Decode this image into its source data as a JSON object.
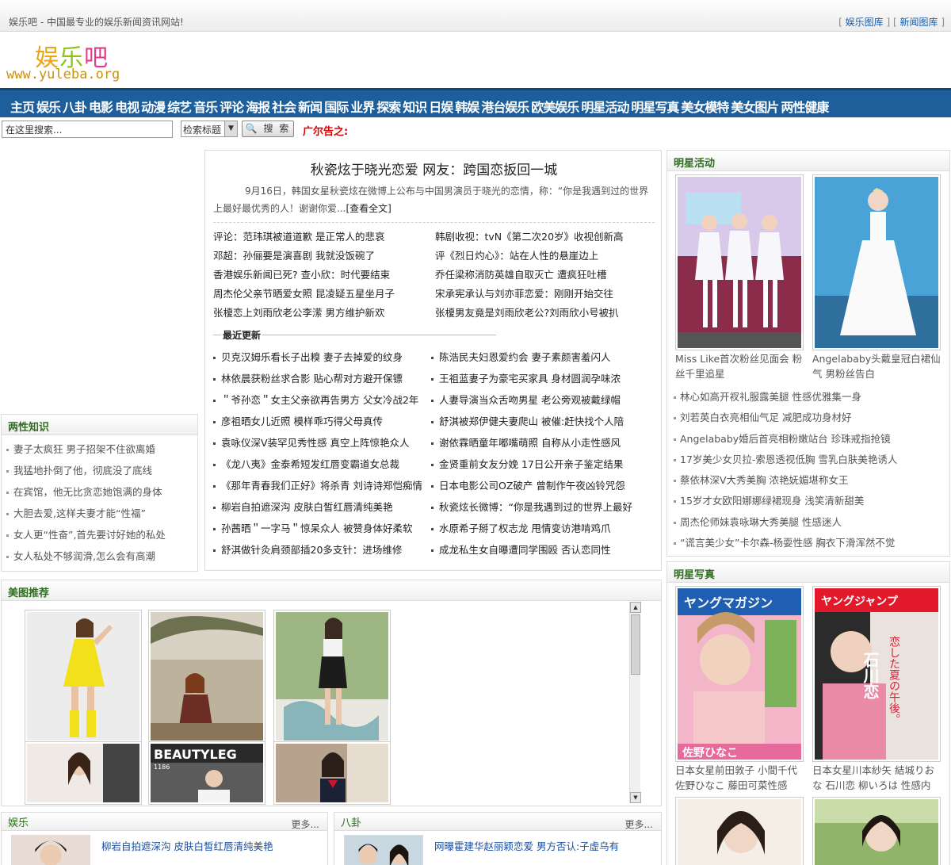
{
  "topbar": {
    "slogan": "娱乐吧 - 中国最专业的娱乐新闻资讯网站!",
    "link1": "娱乐图库",
    "link2": "新闻图库",
    "bracket_open": "[",
    "bracket_close": "]"
  },
  "logo": {
    "c1": "娱",
    "c2": "乐",
    "c3": "吧",
    "url": "www.yuleba.org"
  },
  "nav": [
    "主页",
    "娱乐",
    "八卦",
    "电影",
    "电视",
    "动漫",
    "综艺",
    "音乐",
    "评论",
    "海报",
    "社会",
    "新闻",
    "国际",
    "业界",
    "探索",
    "知识",
    "日娱",
    "韩娱",
    "港台娱乐",
    "欧美娱乐",
    "明星活动",
    "明星写真",
    "美女模特",
    "美女图片",
    "两性健康"
  ],
  "search": {
    "placeholder": "在这里搜索...",
    "select_value": "检索标题",
    "button": "搜 索",
    "ad_label": "广尔告之:"
  },
  "left_panel": {
    "title": "两性知识",
    "items": [
      "妻子太疯狂 男子招架不住欲离婚",
      "我猛地扑倒了他，彻底没了底线",
      "在宾馆，他无比贪恋她饱满的身体",
      "大胆去爱,这样夫妻才能“性福”",
      "女人更“性奋”,首先要讨好她的私处",
      "女人私处不够润滑,怎么会有高潮"
    ]
  },
  "main": {
    "headline": "秋瓷炫于晓光恋爱 网友：跨国恋扳回一城",
    "summary": "9月16日，韩国女星秋瓷炫在微博上公布与中国男演员于晓光的恋情，称：“你是我遇到过的世界上最好最优秀的人！谢谢你爱...",
    "full_link": "[查看全文]",
    "hot_left": [
      "评论：范玮琪被道道歉 是正常人的悲哀",
      "邓超：孙俪要是演喜剧 我就没饭碗了",
      "香港娱乐新闻已死? 查小欣：时代要结束",
      "周杰伦父亲节晒爱女照 昆凌疑五星坐月子",
      "张榎恋上刘雨欣老公李潆 男方维护新欢"
    ],
    "hot_right": [
      "韩剧收视：tvN《第二次20岁》收视创新高",
      "评《烈日灼心》：站在人性的悬崖边上",
      "乔任梁称消防英雄自取灭亡 遭疯狂吐槽",
      "宋承宪承认与刘亦菲恋爱：刚刚开始交往",
      "张榎男友竟是刘雨欣老公?刘雨欣小号被扒"
    ],
    "recent_title": "最近更新",
    "recent_left": [
      "贝克汉姆乐看长子出糗 妻子去掉爱的纹身",
      "林依晨获粉丝求合影 贴心帮对方避开保镖",
      "＂爷孙恋＂女主父亲欲再告男方 父女冷战2年",
      "彦祖晒女儿近照 模样乖巧得父母真传",
      "袁咏仪深V装罕见秀性感 真空上阵惊艳众人",
      "《龙八夷》金泰希短发红唇变霸道女总裁",
      "《那年青春我们正好》将杀青 刘诗诗郑恺痴情",
      "柳岩自拍遮深沟 皮肤白皙红唇清纯美艳",
      "孙茜晒＂一字马＂惊呆众人 被赞身体好柔软",
      "舒淇做针灸肩颈部插20多支针：进场维修"
    ],
    "recent_right": [
      "陈浩民夫妇恩爱约会 妻子素颜害羞闪人",
      "王祖蓝妻子为豪宅买家具 身材圆润孕味浓",
      "人妻导演当众舌吻男星 老公旁观被戴绿帽",
      "舒淇被郑伊健夫妻爬山 被催:赶快找个人陪",
      "谢依霖晒童年嘟嘴萌照 自称从小走性感风",
      "金贤重前女友分娩 17日公开亲子鉴定结果",
      "日本电影公司OZ破产 曾制作午夜凶铃咒怨",
      "秋瓷炫长微博：“你是我遇到过的世界上最好",
      "水原希子掰了权志龙 甩情变访港啃鸡爪",
      "成龙私生女自曝遭同学围殴 否认恋同性"
    ]
  },
  "right_activity": {
    "title": "明星活动",
    "captions": [
      "Miss Like首次粉丝见面会 粉丝千里追星",
      "Angelababy头戴皇冠白裙仙气 男粉丝告白"
    ],
    "items": [
      "林心如高开衩礼服露美腿 性感优雅集一身",
      "刘若英白衣亮相仙气足 减肥成功身材好",
      "Angelababy婚后首亮相粉嫩站台 珍珠戒指抢镜",
      "17岁美少女贝拉-索恩透视低胸 雪乳白肤美艳诱人",
      "蔡依林深V大秀美胸 浓艳妩媚堪称女王",
      "15岁才女欧阳娜娜绿裙现身 浅笑清新甜美",
      "周杰伦师妹袁咏琳大秀美腿 性感迷人",
      "“谎言美少女”卡尔森-杨耍性感 胸衣下滑浑然不觉"
    ]
  },
  "right_photo": {
    "title": "明星写真",
    "captions": [
      "日本女星前田敦子 小間千代 佐野ひなこ 藤田可菜性感",
      "日本女星川本紗矢 結城りおな 石川恋 柳いろは 性感内"
    ],
    "cover1_text": "ヤングマガジン",
    "cover1_name": "佐野ひなこ",
    "cover2_text": "ヤングジャンプ",
    "cover2_name": "石川恋",
    "cover2_line": "恋した夏の午後。"
  },
  "gallery": {
    "title": "美图推荐",
    "beautyleg": "BEAUTYLEG",
    "beautyleg_no": "1186"
  },
  "bottom": {
    "yl_title": "娱乐",
    "yl_more": "更多...",
    "yl_item": "柳岩自拍遮深沟 皮肤白皙红唇清纯美艳",
    "bg_title": "八卦",
    "bg_more": "更多...",
    "bg_item": "网曝霍建华赵丽颖恋爱 男方否认:子虚乌有"
  },
  "colors": {
    "nav_bg": "#1d5e9b",
    "panel_title": "#2e6e1f",
    "ad_red": "#dd0000",
    "link_blue": "#1a5ea8"
  }
}
